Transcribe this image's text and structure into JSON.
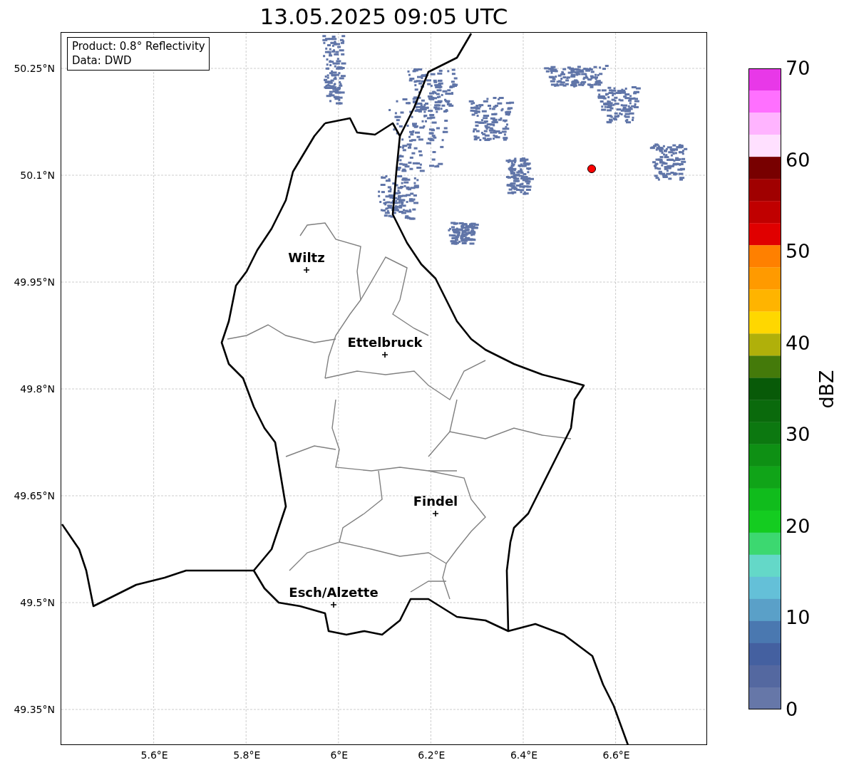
{
  "title": "13.05.2025 09:05 UTC",
  "legend": {
    "lines": [
      "Product: 0.8° Reflectivity",
      "Data: DWD"
    ]
  },
  "map": {
    "x_tick_labels": [
      "5.6°E",
      "5.8°E",
      "6°E",
      "6.2°E",
      "6.4°E",
      "6.6°E"
    ],
    "y_tick_labels": [
      "50.25°N",
      "50.1°N",
      "49.95°N",
      "49.8°N",
      "49.65°N",
      "49.5°N",
      "49.35°N"
    ],
    "cities": [
      {
        "name": "Wiltz"
      },
      {
        "name": "Ettelbruck"
      },
      {
        "name": "Findel"
      },
      {
        "name": "Esch/Alzette"
      }
    ]
  },
  "colorbar": {
    "label": "dBZ",
    "ticks": [
      "70",
      "60",
      "50",
      "40",
      "30",
      "20",
      "10",
      "0"
    ],
    "bins": [
      {
        "color": "#e838e8"
      },
      {
        "color": "#ff70ff"
      },
      {
        "color": "#ffb4ff"
      },
      {
        "color": "#ffe0ff"
      },
      {
        "color": "#780000"
      },
      {
        "color": "#a00000"
      },
      {
        "color": "#c00000"
      },
      {
        "color": "#e00000"
      },
      {
        "color": "#ff8000"
      },
      {
        "color": "#ff9a00"
      },
      {
        "color": "#ffb400"
      },
      {
        "color": "#ffd700"
      },
      {
        "color": "#b0b00a"
      },
      {
        "color": "#447a0a"
      },
      {
        "color": "#085a08"
      },
      {
        "color": "#0a6a0c"
      },
      {
        "color": "#0c7810"
      },
      {
        "color": "#0e9014"
      },
      {
        "color": "#10a418"
      },
      {
        "color": "#10bc1c"
      },
      {
        "color": "#14cc20"
      },
      {
        "color": "#3cd870"
      },
      {
        "color": "#64d8c8"
      },
      {
        "color": "#64c0d8"
      },
      {
        "color": "#5aa0c8"
      },
      {
        "color": "#4a78b0"
      },
      {
        "color": "#4460a0"
      },
      {
        "color": "#5468a0"
      },
      {
        "color": "#6677a8"
      }
    ]
  }
}
